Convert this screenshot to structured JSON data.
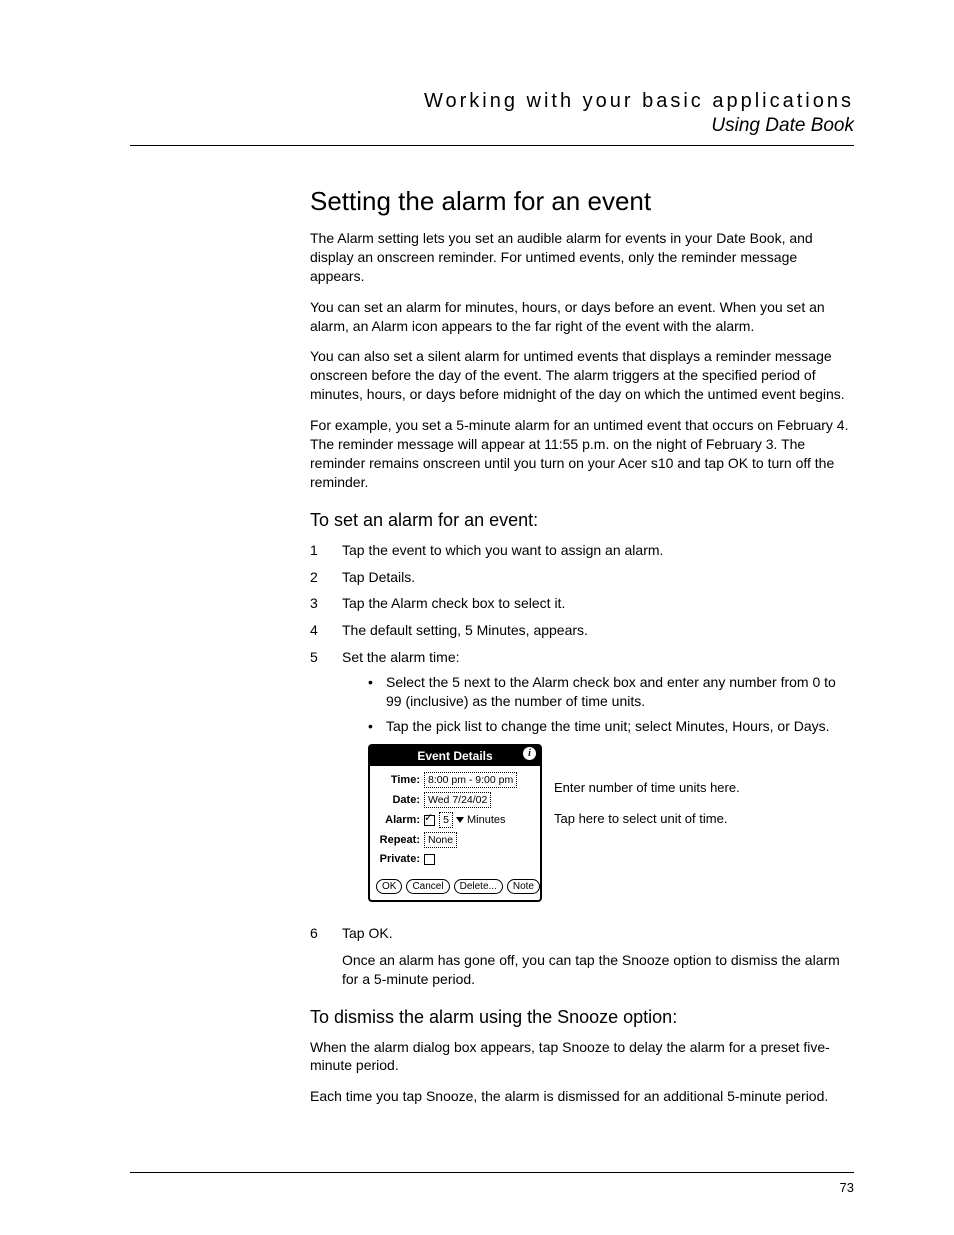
{
  "header": {
    "chapter": "Working with your basic applications",
    "section": "Using Date Book"
  },
  "h1": "Setting the alarm for an event",
  "intro": [
    "The Alarm setting lets you set an audible alarm for events in your Date Book, and display an onscreen reminder. For untimed events, only the reminder message appears.",
    "You can set an alarm for minutes, hours, or days before an event. When you set an alarm, an Alarm icon appears to the far right of the event with the alarm.",
    "You can also set a silent alarm for untimed events that displays a reminder message onscreen before the day of the event. The alarm triggers at the specified period of minutes, hours, or days before midnight of the day on which the untimed event begins.",
    "For example, you set a 5-minute alarm for an untimed event that occurs on February 4. The reminder message will appear at 11:55 p.m. on the night of February 3. The reminder remains onscreen until you turn on your Acer s10 and tap OK to turn off the reminder."
  ],
  "h2a": "To set an alarm for an event:",
  "steps": [
    {
      "n": "1",
      "t": "Tap the event to which you want to assign an alarm."
    },
    {
      "n": "2",
      "t": "Tap Details."
    },
    {
      "n": "3",
      "t": "Tap the Alarm check box to select it."
    },
    {
      "n": "4",
      "t": "The default setting, 5 Minutes, appears."
    },
    {
      "n": "5",
      "t": "Set the alarm time:"
    }
  ],
  "bullets": [
    "Select the 5 next to the Alarm check box and enter any number from 0 to 99 (inclusive) as the number of time units.",
    "Tap the pick list to change the time unit; select Minutes, Hours, or Days."
  ],
  "device": {
    "title": "Event Details",
    "rows": {
      "time_label": "Time:",
      "time_value": "8:00 pm - 9:00 pm",
      "date_label": "Date:",
      "date_value": "Wed 7/24/02",
      "alarm_label": "Alarm:",
      "alarm_value": "5",
      "alarm_unit": "Minutes",
      "repeat_label": "Repeat:",
      "repeat_value": "None",
      "private_label": "Private:"
    },
    "buttons": {
      "ok": "OK",
      "cancel": "Cancel",
      "delete": "Delete...",
      "note": "Note"
    }
  },
  "callouts": {
    "c1": "Enter number of time units here.",
    "c2": "Tap here to select unit of time."
  },
  "step6": {
    "n": "6",
    "t": "Tap OK."
  },
  "post6": "Once an alarm has gone off, you can tap the Snooze option to dismiss the alarm for a 5-minute period.",
  "h2b": "To dismiss the alarm using the Snooze option:",
  "snooze": [
    "When the alarm dialog box appears, tap Snooze to delay the alarm for a preset five-minute period.",
    "Each time you tap Snooze, the alarm is dismissed for an additional 5-minute period."
  ],
  "page_number": "73"
}
